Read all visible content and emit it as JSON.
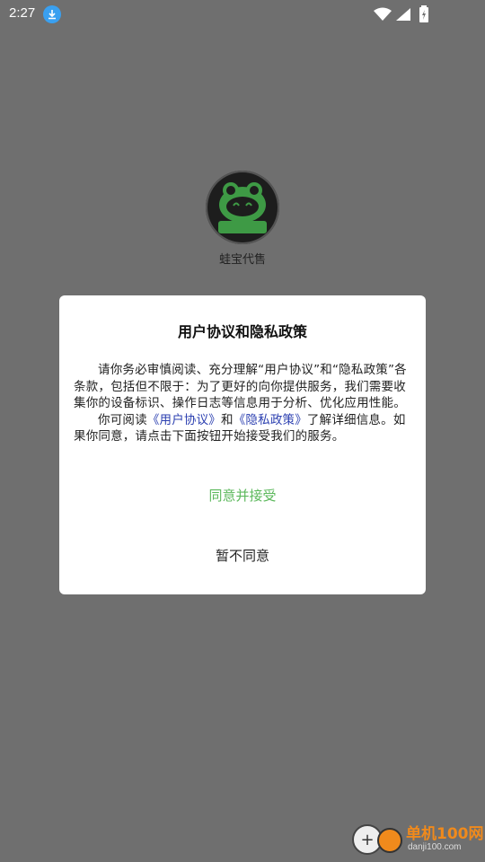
{
  "status_bar": {
    "time": "2:27"
  },
  "app": {
    "name": "蛙宝代售",
    "logo_text": "蛙宝代售"
  },
  "dialog": {
    "title": "用户协议和隐私政策",
    "para1": "请你务必审慎阅读、充分理解“用户协议”和“隐私政策”各条款，包括但不限于：为了更好的向你提供服务，我们需要收集你的设备标识、操作日志等信息用于分析、优化应用性能。",
    "para2_prefix": "你可阅读",
    "link_user": "《用户协议》",
    "para2_and": "和",
    "link_privacy": "《隐私政策》",
    "para2_suffix": "了解详细信息。如果你同意，请点击下面按钮开始接受我们的服务。",
    "agree_label": "同意并接受",
    "disagree_label": "暂不同意"
  },
  "watermark": {
    "brand": "单机100网",
    "url": "danji100.com"
  },
  "colors": {
    "agree": "#5cb85c",
    "link": "#2b3fb0",
    "overlay": "#6f6f6f"
  }
}
